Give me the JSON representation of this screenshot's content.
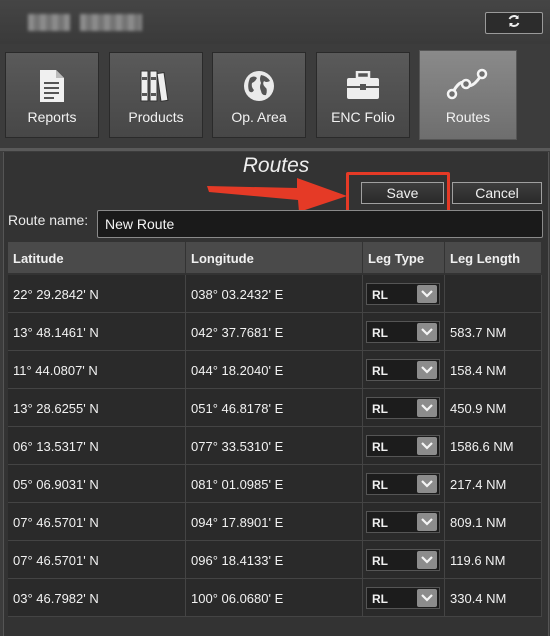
{
  "toolbar": {
    "tiles": [
      {
        "label": "Reports",
        "icon": "document-icon"
      },
      {
        "label": "Products",
        "icon": "books-icon"
      },
      {
        "label": "Op. Area",
        "icon": "globe-icon"
      },
      {
        "label": "ENC Folio",
        "icon": "briefcase-icon"
      },
      {
        "label": "Routes",
        "icon": "route-icon",
        "active": true
      }
    ]
  },
  "panel": {
    "title": "Routes",
    "save_label": "Save",
    "cancel_label": "Cancel",
    "route_name_label": "Route name:",
    "route_name_value": "New Route"
  },
  "table": {
    "headers": {
      "latitude": "Latitude",
      "longitude": "Longitude",
      "leg_type": "Leg Type",
      "leg_length": "Leg Length"
    },
    "rows": [
      {
        "lat": "22° 29.2842' N",
        "lon": "038° 03.2432' E",
        "type": "RL",
        "len": ""
      },
      {
        "lat": "13° 48.1461' N",
        "lon": "042° 37.7681' E",
        "type": "RL",
        "len": "583.7 NM"
      },
      {
        "lat": "11° 44.0807' N",
        "lon": "044° 18.2040' E",
        "type": "RL",
        "len": "158.4 NM"
      },
      {
        "lat": "13° 28.6255' N",
        "lon": "051° 46.8178' E",
        "type": "RL",
        "len": "450.9 NM"
      },
      {
        "lat": "06° 13.5317' N",
        "lon": "077° 33.5310' E",
        "type": "RL",
        "len": "1586.6 NM"
      },
      {
        "lat": "05° 06.9031' N",
        "lon": "081° 01.0985' E",
        "type": "RL",
        "len": "217.4 NM"
      },
      {
        "lat": "07° 46.5701' N",
        "lon": "094° 17.8901' E",
        "type": "RL",
        "len": "809.1 NM"
      },
      {
        "lat": "07° 46.5701' N",
        "lon": "096° 18.4133' E",
        "type": "RL",
        "len": "119.6 NM"
      },
      {
        "lat": "03° 46.7982' N",
        "lon": "100° 06.0680' E",
        "type": "RL",
        "len": "330.4 NM"
      }
    ]
  },
  "colors": {
    "highlight": "#e53a26",
    "background": "#3c3c3c"
  }
}
